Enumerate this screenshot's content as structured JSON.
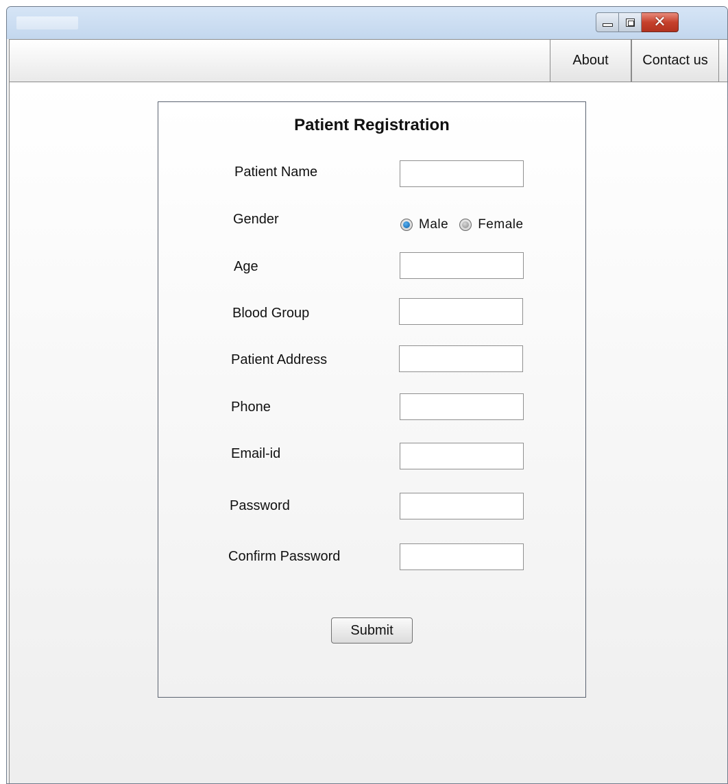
{
  "window": {
    "title": "",
    "controls": {
      "minimize_icon": "minimize-icon",
      "maximize_icon": "maximize-icon",
      "close_icon": "close-icon",
      "close_glyph": "✕",
      "close_color": "#c6412c"
    }
  },
  "nav": {
    "about_label": "About",
    "contact_label": "Contact us"
  },
  "form": {
    "title": "Patient Registration",
    "fields": {
      "patient_name": {
        "label": "Patient Name",
        "value": ""
      },
      "gender": {
        "label": "Gender",
        "options": [
          "Male",
          "Female"
        ],
        "selected": "Male"
      },
      "age": {
        "label": "Age",
        "value": ""
      },
      "blood_group": {
        "label": "Blood Group",
        "value": ""
      },
      "patient_address": {
        "label": "Patient Address",
        "value": ""
      },
      "phone": {
        "label": "Phone",
        "value": ""
      },
      "email": {
        "label": "Email-id",
        "value": ""
      },
      "password": {
        "label": "Password",
        "value": ""
      },
      "confirm_password": {
        "label": "Confirm Password",
        "value": ""
      }
    },
    "submit_label": "Submit"
  },
  "colors": {
    "radio_selected": "#0a5fa8",
    "titlebar": "#c3d7ee"
  }
}
